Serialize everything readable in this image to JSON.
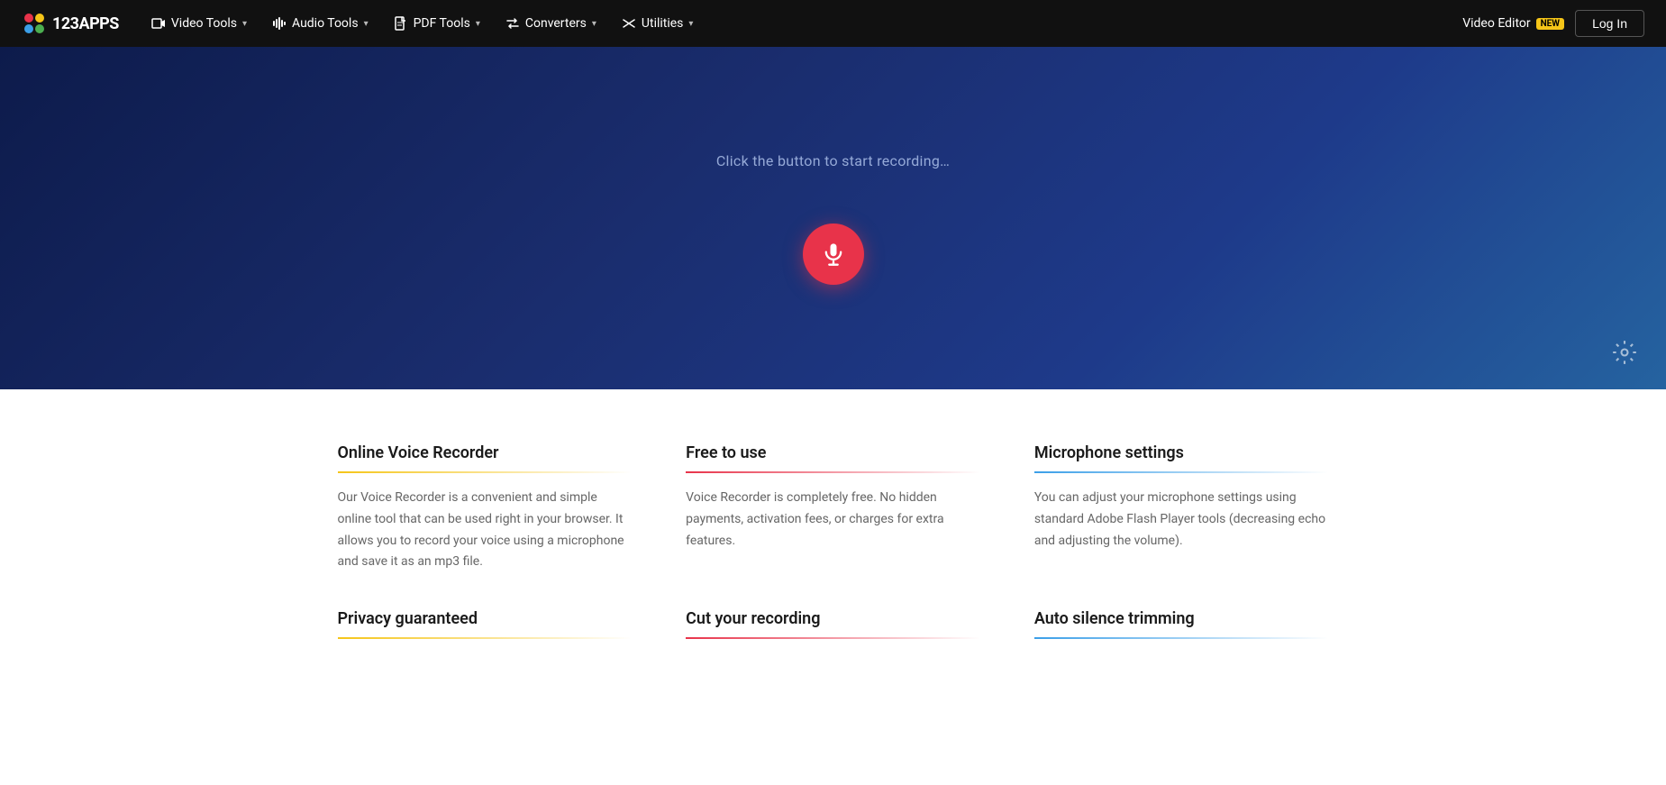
{
  "brand": {
    "name": "123APPS",
    "logo_alt": "123apps logo"
  },
  "navbar": {
    "items": [
      {
        "id": "video-tools",
        "label": "Video Tools",
        "icon": "video-icon"
      },
      {
        "id": "audio-tools",
        "label": "Audio Tools",
        "icon": "audio-icon"
      },
      {
        "id": "pdf-tools",
        "label": "PDF Tools",
        "icon": "pdf-icon"
      },
      {
        "id": "converters",
        "label": "Converters",
        "icon": "converters-icon"
      },
      {
        "id": "utilities",
        "label": "Utilities",
        "icon": "utilities-icon"
      }
    ],
    "video_editor_label": "Video Editor",
    "new_badge": "NEW",
    "login_label": "Log In"
  },
  "hero": {
    "hint": "Click the button to start recording…",
    "record_button_aria": "Start recording",
    "settings_aria": "Settings"
  },
  "features": [
    {
      "id": "online-voice-recorder",
      "title": "Online Voice Recorder",
      "color": "yellow",
      "text": "Our Voice Recorder is a convenient and simple online tool that can be used right in your browser. It allows you to record your voice using a microphone and save it as an mp3 file."
    },
    {
      "id": "free-to-use",
      "title": "Free to use",
      "color": "red",
      "text": "Voice Recorder is completely free. No hidden payments, activation fees, or charges for extra features."
    },
    {
      "id": "microphone-settings",
      "title": "Microphone settings",
      "color": "blue",
      "text": "You can adjust your microphone settings using standard Adobe Flash Player tools (decreasing echo and adjusting the volume)."
    },
    {
      "id": "privacy-guaranteed",
      "title": "Privacy guaranteed",
      "color": "yellow",
      "text": ""
    },
    {
      "id": "cut-your-recording",
      "title": "Cut your recording",
      "color": "red",
      "text": ""
    },
    {
      "id": "auto-silence-trimming",
      "title": "Auto silence trimming",
      "color": "blue",
      "text": ""
    }
  ]
}
